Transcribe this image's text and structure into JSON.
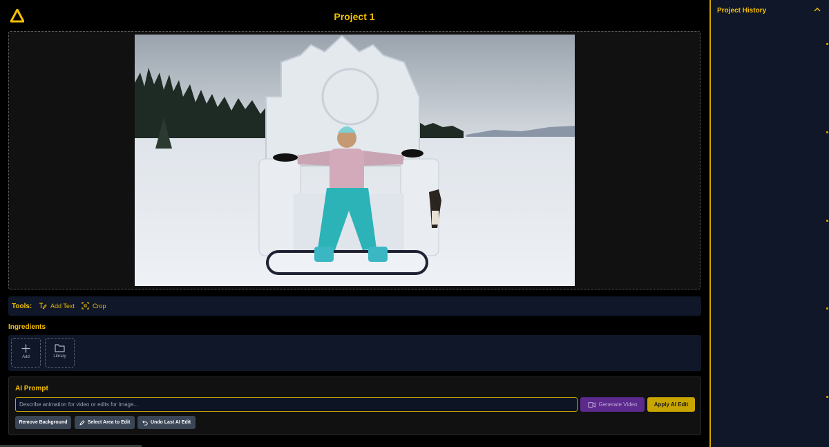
{
  "app": {
    "title": "Project 1",
    "accent_color": "#f5c000",
    "logo_icon": "triangle-logo-icon"
  },
  "canvas": {
    "image_description": "photo"
  },
  "tools": {
    "label": "Tools:",
    "items": [
      {
        "label": "Add Text",
        "icon": "text-edit-icon"
      },
      {
        "label": "Crop",
        "icon": "crop-icon"
      }
    ]
  },
  "ingredients": {
    "title": "Ingredients",
    "buttons": [
      {
        "label": "Add",
        "icon": "plus-icon"
      },
      {
        "label": "Library",
        "icon": "folder-icon"
      }
    ]
  },
  "ai_prompt": {
    "title": "AI Prompt",
    "placeholder": "Describe animation for video or edits for image...",
    "generate_label": "Generate Video",
    "apply_label": "Apply AI Edit",
    "remove_bg_label": "Remove Background",
    "select_area_label": "Select Area to Edit",
    "undo_label": "Undo Last AI Edit"
  },
  "sidebar": {
    "title": "Project History"
  }
}
